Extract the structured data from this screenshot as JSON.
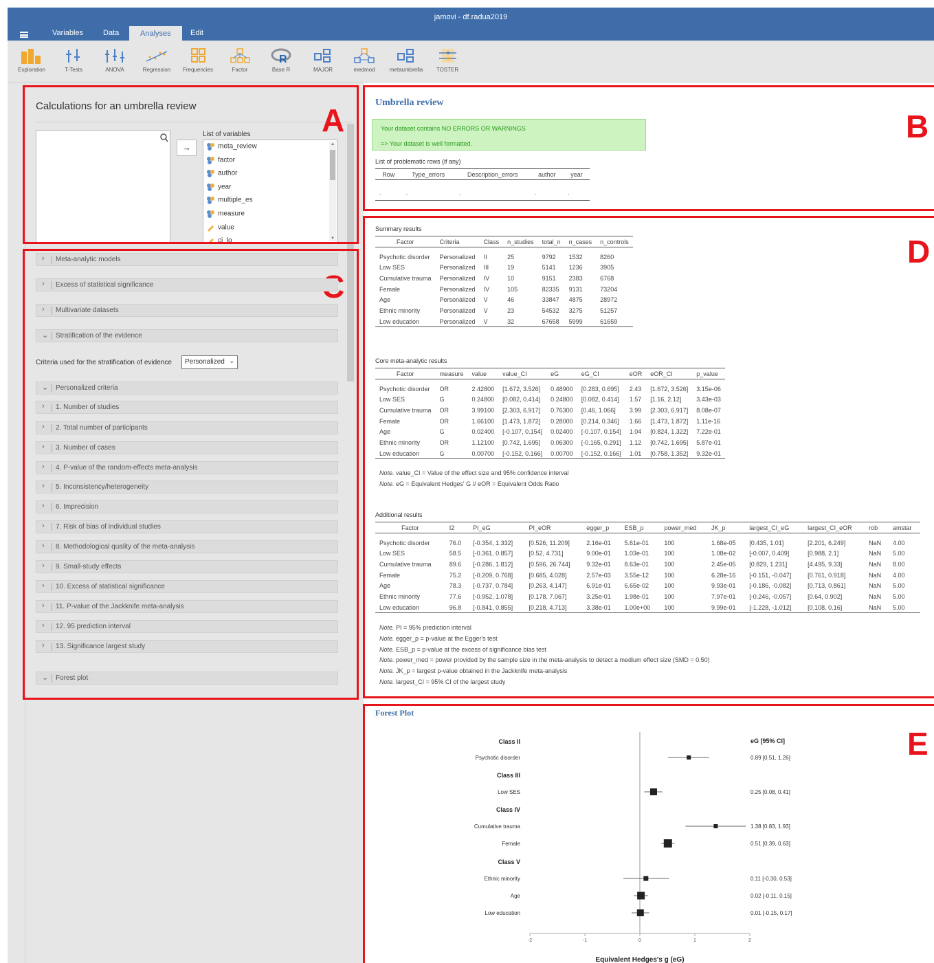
{
  "window": {
    "title": "jamovi - df.radua2019"
  },
  "menu": {
    "tabs": [
      "Variables",
      "Data",
      "Analyses",
      "Edit"
    ],
    "active": "Analyses"
  },
  "toolbar": {
    "items": [
      "Exploration",
      "T-Tests",
      "ANOVA",
      "Regression",
      "Frequencies",
      "Factor",
      "Base R",
      "MAJOR",
      "medmod",
      "metaumbrella",
      "TOSTER"
    ]
  },
  "panel_a": {
    "title": "Calculations for an umbrella review",
    "list_label": "List of variables",
    "arrow": "→",
    "variables": [
      "meta_review",
      "factor",
      "author",
      "year",
      "multiple_es",
      "measure",
      "value",
      "ci_lo"
    ]
  },
  "panel_c": {
    "sections_top": [
      "Meta-analytic models",
      "Excess of statistical significance",
      "Multivariate datasets",
      "Stratification of the evidence"
    ],
    "criteria_label": "Criteria used for the stratification of evidence",
    "criteria_value": "Personalized",
    "personalized_label": "Personalized criteria",
    "criteria": [
      "1. Number of studies",
      "2. Total number of participants",
      "3. Number of cases",
      "4. P-value of the random-effects meta-analysis",
      "5. Inconsistency/heterogeneity",
      "6. Imprecision",
      "7. Risk of bias of individual studies",
      "8. Methodological quality of the meta-analysis",
      "9. Small-study effects",
      "10. Excess of statistical significance",
      "11. P-value of the Jackknife meta-analysis",
      "12. 95 prediction interval",
      "13. Significance largest study"
    ],
    "forest_label": "Forest plot"
  },
  "panel_b": {
    "title": "Umbrella review",
    "msg1": "Your dataset contains NO ERRORS OR WARNINGS",
    "msg2": "=> Your dataset is well formatted.",
    "problem_title": "List of problematic rows (if any)",
    "problem_headers": [
      "Row",
      "Type_errors",
      "Description_errors",
      "author",
      "year"
    ],
    "problem_row": [
      ".",
      ".",
      ".",
      ".",
      "."
    ]
  },
  "summary": {
    "title": "Summary results",
    "headers": [
      "Factor",
      "Criteria",
      "Class",
      "n_studies",
      "total_n",
      "n_cases",
      "n_controls"
    ],
    "rows": [
      [
        "Psychotic disorder",
        "Personalized",
        "II",
        "25",
        "9792",
        "1532",
        "8260"
      ],
      [
        "Low SES",
        "Personalized",
        "III",
        "19",
        "5141",
        "1236",
        "3905"
      ],
      [
        "Cumulative trauma",
        "Personalized",
        "IV",
        "10",
        "9151",
        "2383",
        "6768"
      ],
      [
        "Female",
        "Personalized",
        "IV",
        "105",
        "82335",
        "9131",
        "73204"
      ],
      [
        "Age",
        "Personalized",
        "V",
        "46",
        "33847",
        "4875",
        "28972"
      ],
      [
        "Ethnic minority",
        "Personalized",
        "V",
        "23",
        "54532",
        "3275",
        "51257"
      ],
      [
        "Low education",
        "Personalized",
        "V",
        "32",
        "67658",
        "5999",
        "61659"
      ]
    ]
  },
  "core": {
    "title": "Core meta-analytic results",
    "headers": [
      "Factor",
      "measure",
      "value",
      "value_CI",
      "eG",
      "eG_CI",
      "eOR",
      "eOR_CI",
      "p_value"
    ],
    "rows": [
      [
        "Psychotic disorder",
        "OR",
        "2.42800",
        "[1.672, 3.526]",
        "0.48900",
        "[0.283, 0.695]",
        "2.43",
        "[1.672, 3.526]",
        "3.15e-06"
      ],
      [
        "Low SES",
        "G",
        "0.24800",
        "[0.082, 0.414]",
        "0.24800",
        "[0.082, 0.414]",
        "1.57",
        "[1.16, 2.12]",
        "3.43e-03"
      ],
      [
        "Cumulative trauma",
        "OR",
        "3.99100",
        "[2.303, 6.917]",
        "0.76300",
        "[0.46, 1.066]",
        "3.99",
        "[2.303, 6.917]",
        "8.08e-07"
      ],
      [
        "Female",
        "OR",
        "1.66100",
        "[1.473, 1.872]",
        "0.28000",
        "[0.214, 0.346]",
        "1.66",
        "[1.473, 1.872]",
        "1.11e-16"
      ],
      [
        "Age",
        "G",
        "0.02400",
        "[-0.107, 0.154]",
        "0.02400",
        "[-0.107, 0.154]",
        "1.04",
        "[0.824, 1.322]",
        "7.22e-01"
      ],
      [
        "Ethnic minority",
        "OR",
        "1.12100",
        "[0.742, 1.695]",
        "0.06300",
        "[-0.165, 0.291]",
        "1.12",
        "[0.742, 1.695]",
        "5.87e-01"
      ],
      [
        "Low education",
        "G",
        "0.00700",
        "[-0.152, 0.166]",
        "0.00700",
        "[-0.152, 0.166]",
        "1.01",
        "[0.758, 1.352]",
        "9.32e-01"
      ]
    ],
    "notes": [
      [
        "Note.",
        "value_CI = Value of the effect size and 95% confidence interval"
      ],
      [
        "Note.",
        "eG = Equivalent Hedges' G // eOR = Equivalent Odds Ratio"
      ]
    ]
  },
  "additional": {
    "title": "Additional results",
    "headers": [
      "Factor",
      "I2",
      "PI_eG",
      "PI_eOR",
      "egger_p",
      "ESB_p",
      "power_med",
      "JK_p",
      "largest_CI_eG",
      "largest_CI_eOR",
      "rob",
      "amstar"
    ],
    "rows": [
      [
        "Psychotic disorder",
        "76.0",
        "[-0.354, 1.332]",
        "[0.526, 11.209]",
        "2.16e-01",
        "5.61e-01",
        "100",
        "1.68e-05",
        "[0.435, 1.01]",
        "[2.201, 6.249]",
        "NaN",
        "4.00"
      ],
      [
        "Low SES",
        "58.5",
        "[-0.361, 0.857]",
        "[0.52, 4.731]",
        "9.00e-01",
        "1.03e-01",
        "100",
        "1.08e-02",
        "[-0.007, 0.409]",
        "[0.988, 2.1]",
        "NaN",
        "5.00"
      ],
      [
        "Cumulative trauma",
        "89.6",
        "[-0.286, 1.812]",
        "[0.596, 26.744]",
        "9.32e-01",
        "8.63e-01",
        "100",
        "2.45e-05",
        "[0.829, 1.231]",
        "[4.495, 9.33]",
        "NaN",
        "8.00"
      ],
      [
        "Female",
        "75.2",
        "[-0.209, 0.768]",
        "[0.685, 4.028]",
        "2.57e-03",
        "3.55e-12",
        "100",
        "6.28e-16",
        "[-0.151, -0.047]",
        "[0.761, 0.918]",
        "NaN",
        "4.00"
      ],
      [
        "Age",
        "78.3",
        "[-0.737, 0.784]",
        "[0.263, 4.147]",
        "6.91e-01",
        "6.65e-02",
        "100",
        "9.93e-01",
        "[-0.186, -0.082]",
        "[0.713, 0.861]",
        "NaN",
        "5.00"
      ],
      [
        "Ethnic minority",
        "77.6",
        "[-0.952, 1.078]",
        "[0.178, 7.067]",
        "3.25e-01",
        "1.98e-01",
        "100",
        "7.97e-01",
        "[-0.246, -0.057]",
        "[0.64, 0.902]",
        "NaN",
        "5.00"
      ],
      [
        "Low education",
        "96.8",
        "[-0.841, 0.855]",
        "[0.218, 4.713]",
        "3.38e-01",
        "1.00e+00",
        "100",
        "9.99e-01",
        "[-1.228, -1.012]",
        "[0.108, 0.16]",
        "NaN",
        "5.00"
      ]
    ],
    "notes": [
      [
        "Note.",
        "PI = 95% prediction interval"
      ],
      [
        "Note.",
        "egger_p = p-value at the Egger's test"
      ],
      [
        "Note.",
        "ESB_p = p-value at the excess of significance bias test"
      ],
      [
        "Note.",
        "power_med = power provided by the sample size in the meta-analysis to detect a medium effect size (SMD = 0.50)"
      ],
      [
        "Note.",
        "JK_p = largest p-value obtained in the Jackknife meta-analysis"
      ],
      [
        "Note.",
        "largest_CI = 95% CI of the largest study"
      ]
    ]
  },
  "forest": {
    "title": "Forest Plot",
    "header": "eG [95% CI]",
    "xlabel": "Equivalent Hedges's g (eG)",
    "ticks": [
      "-2",
      "-1",
      "0",
      "1",
      "2"
    ],
    "rows": [
      {
        "type": "class",
        "label": "Class II"
      },
      {
        "type": "study",
        "label": "Psychotic disorder",
        "text": "0.89 [0.51, 1.26]"
      },
      {
        "type": "class",
        "label": "Class III"
      },
      {
        "type": "study",
        "label": "Low SES",
        "text": "0.25 [0.08, 0.41]"
      },
      {
        "type": "class",
        "label": "Class IV"
      },
      {
        "type": "study",
        "label": "Cumulative trauma",
        "text": "1.38 [0.83, 1.93]"
      },
      {
        "type": "study",
        "label": "Female",
        "text": "0.51 [0.39, 0.63]"
      },
      {
        "type": "class",
        "label": "Class V"
      },
      {
        "type": "study",
        "label": "Ethnic minority",
        "text": "0.11 [-0.30, 0.53]"
      },
      {
        "type": "study",
        "label": "Age",
        "text": "0.02 [-0.11, 0.15]"
      },
      {
        "type": "study",
        "label": "Low education",
        "text": "0.01 [-0.15, 0.17]"
      }
    ]
  },
  "chart_data": {
    "type": "scatter",
    "xlabel": "Equivalent Hedges's g (eG)",
    "xlim": [
      -2,
      2
    ],
    "series": [
      {
        "values": [
          {
            "study": "Psychotic disorder",
            "eG": 0.89,
            "lo": 0.51,
            "hi": 1.26
          },
          {
            "study": "Low SES",
            "eG": 0.25,
            "lo": 0.08,
            "hi": 0.41
          },
          {
            "study": "Cumulative trauma",
            "eG": 1.38,
            "lo": 0.83,
            "hi": 1.93
          },
          {
            "study": "Female",
            "eG": 0.51,
            "lo": 0.39,
            "hi": 0.63
          },
          {
            "study": "Ethnic minority",
            "eG": 0.11,
            "lo": -0.3,
            "hi": 0.53
          },
          {
            "study": "Age",
            "eG": 0.02,
            "lo": -0.11,
            "hi": 0.15
          },
          {
            "study": "Low education",
            "eG": 0.01,
            "lo": -0.15,
            "hi": 0.17
          }
        ]
      }
    ]
  },
  "annotations": {
    "labels": [
      "A",
      "B",
      "C",
      "D",
      "E"
    ]
  },
  "colors": {
    "title_bar": "#3e6da9",
    "annotation_red": "#e8141b",
    "success_bg": "#ccf3c0",
    "success_text": "#2c9a1d"
  }
}
